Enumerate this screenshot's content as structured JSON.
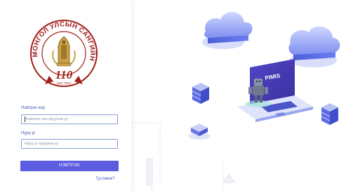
{
  "logo": {
    "text": "МОНГОЛ УЛСЫН САНГИЙН ЯАМ",
    "anniversary": "110",
    "years": "1911 2021"
  },
  "login_form": {
    "username_label": "Нэвтрэх нэр",
    "username_placeholder": "Нэвтрэх нэр оруулна уу",
    "password_label": "Нууц үг",
    "password_placeholder": "Нууц үг оруулна уу",
    "submit_label": "НЭВТРЭХ",
    "help_link": "Тусламж?"
  },
  "illustration": {
    "screen_text": "PIMIS"
  },
  "colors": {
    "accent": "#5b5ce0",
    "label_blue": "#3f51b5",
    "logo_red": "#a21f1a",
    "logo_gold": "#c9a045"
  }
}
